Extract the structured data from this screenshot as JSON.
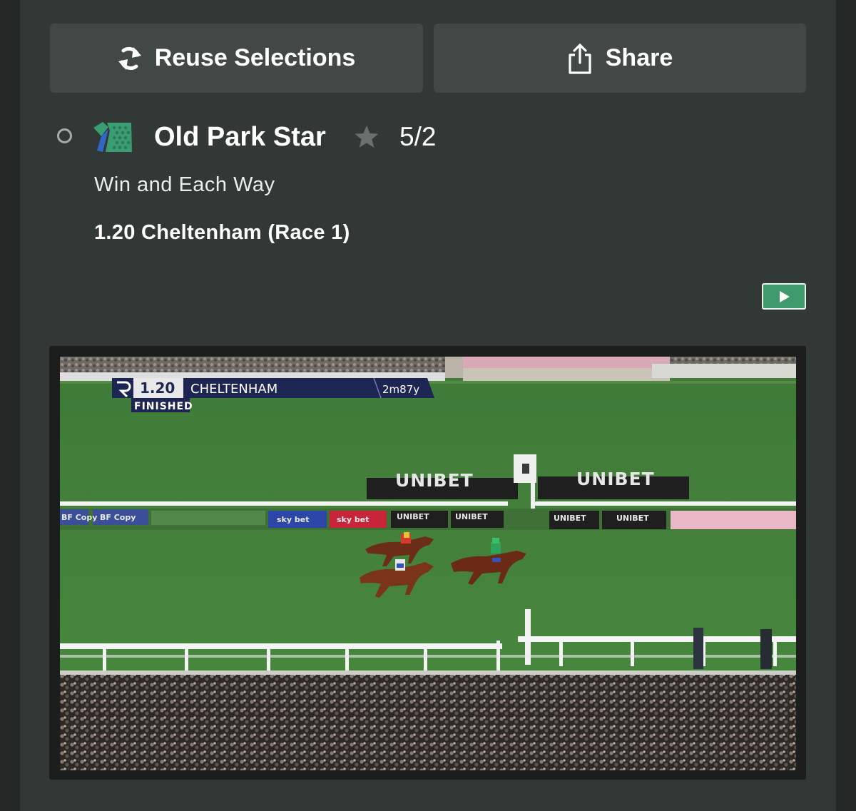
{
  "actions": {
    "reuse_label": "Reuse Selections",
    "reuse_icon": "refresh-icon",
    "share_label": "Share",
    "share_icon": "share-icon"
  },
  "selection": {
    "runner_name": "Old Park Star",
    "odds": "5/2",
    "bet_type": "Win and Each Way",
    "race": "1.20 Cheltenham (Race 1)",
    "silks_icon": "jockey-silks-icon",
    "favourite_icon": "star-icon"
  },
  "video": {
    "play_icon": "play-icon",
    "overlay": {
      "time": "1.20",
      "course": "CHELTENHAM",
      "distance": "2m87y",
      "status": "FINISHED"
    },
    "boards": [
      "UNIBET",
      "UNIBET"
    ],
    "rail_ads": [
      "BF Copy",
      "BF Copy",
      "sky bet",
      "sky bet",
      "UNIBET",
      "UNIBET",
      "UNIBET",
      "UNIBET"
    ]
  },
  "colors": {
    "panel": "#323836",
    "button": "#414845",
    "accent_green": "#3f9a6c",
    "text": "#ffffff"
  }
}
